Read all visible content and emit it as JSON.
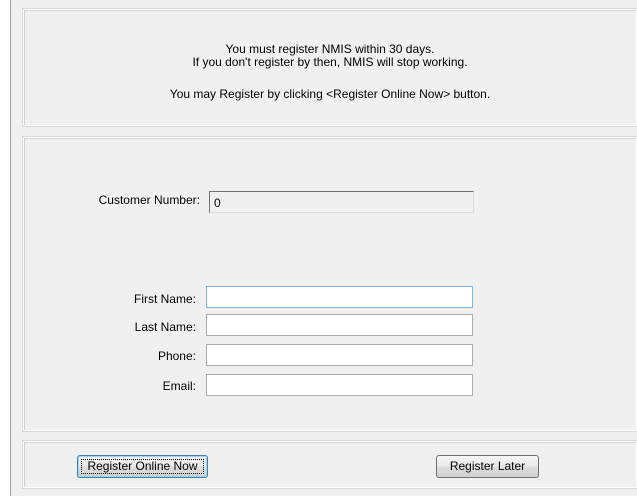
{
  "info": {
    "line1": "You must register NMIS within 30 days.",
    "line2": "If you don't register by then, NMIS will stop working.",
    "line3": "You may Register by clicking <Register Online Now> button."
  },
  "form": {
    "customer_number": {
      "label": "Customer Number:",
      "value": "0"
    },
    "first_name": {
      "label": "First Name:",
      "value": ""
    },
    "last_name": {
      "label": "Last Name:",
      "value": ""
    },
    "phone": {
      "label": "Phone:",
      "value": ""
    },
    "email": {
      "label": "Email:",
      "value": ""
    }
  },
  "buttons": {
    "register_online": "Register Online Now",
    "register_later": "Register Later"
  }
}
